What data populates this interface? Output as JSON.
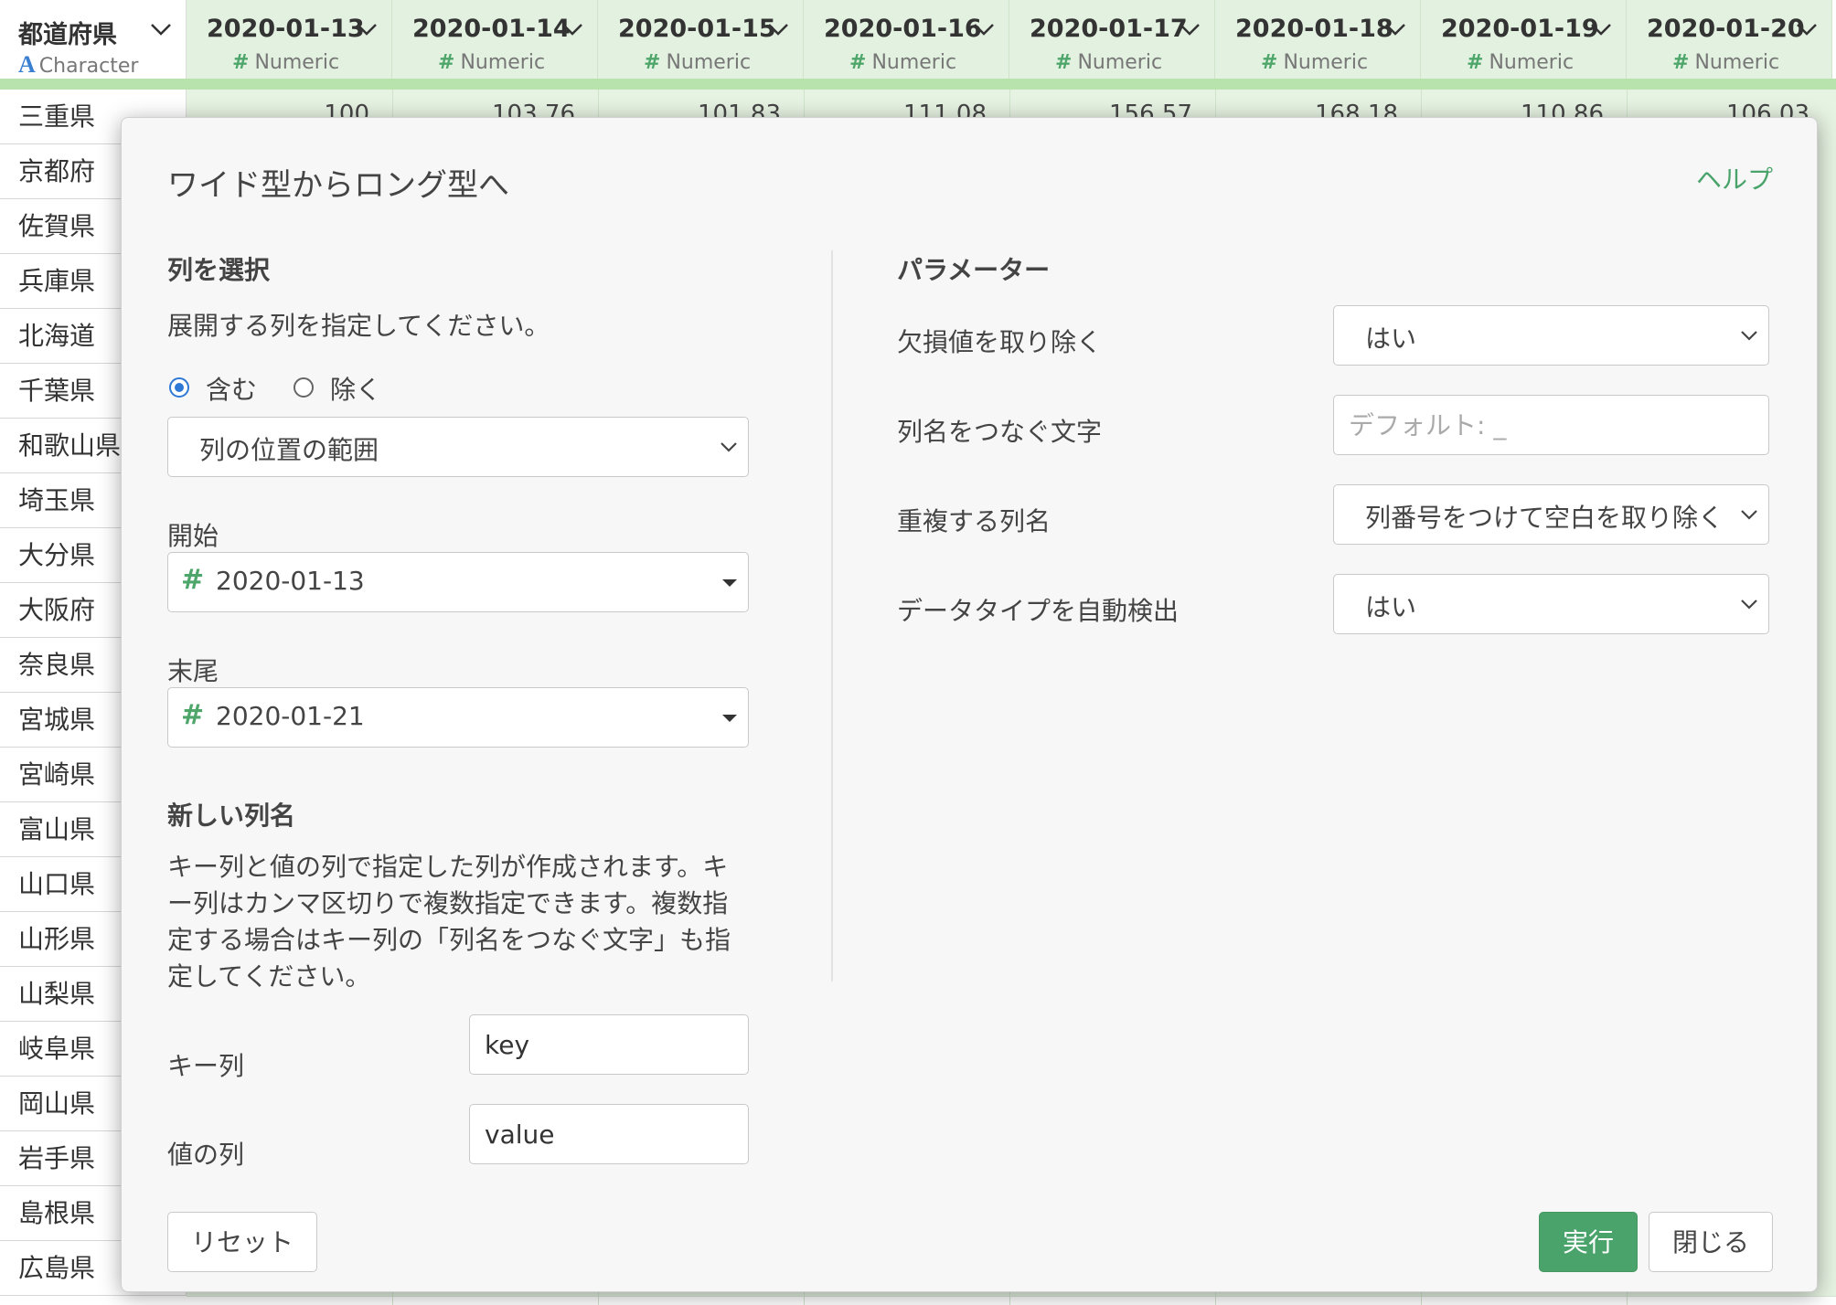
{
  "grid": {
    "first_column": {
      "name": "都道府県",
      "type_icon": "A",
      "type": "Character"
    },
    "columns": [
      {
        "name": "2020-01-13",
        "type": "Numeric",
        "first_value": "100"
      },
      {
        "name": "2020-01-14",
        "type": "Numeric",
        "first_value": "103.76"
      },
      {
        "name": "2020-01-15",
        "type": "Numeric",
        "first_value": "101.83"
      },
      {
        "name": "2020-01-16",
        "type": "Numeric",
        "first_value": "111.08"
      },
      {
        "name": "2020-01-17",
        "type": "Numeric",
        "first_value": "156.57"
      },
      {
        "name": "2020-01-18",
        "type": "Numeric",
        "first_value": "168.18"
      },
      {
        "name": "2020-01-19",
        "type": "Numeric",
        "first_value": "110.86"
      },
      {
        "name": "2020-01-20",
        "type": "Numeric",
        "first_value": "106.03"
      }
    ],
    "numeric_icon": "#",
    "rows": [
      "三重県",
      "京都府",
      "佐賀県",
      "兵庫県",
      "北海道",
      "千葉県",
      "和歌山県",
      "埼玉県",
      "大分県",
      "大阪府",
      "奈良県",
      "宮城県",
      "宮崎県",
      "富山県",
      "山口県",
      "山形県",
      "山梨県",
      "岐阜県",
      "岡山県",
      "岩手県",
      "島根県",
      "広島県"
    ]
  },
  "modal": {
    "title": "ワイド型からロング型へ",
    "help": "ヘルプ",
    "select_columns": {
      "title": "列を選択",
      "description": "展開する列を指定してください。",
      "include_label": "含む",
      "exclude_label": "除く",
      "mode": "列の位置の範囲",
      "start_label": "開始",
      "start_value": "2020-01-13",
      "end_label": "末尾",
      "end_value": "2020-01-21"
    },
    "new_columns": {
      "title": "新しい列名",
      "description": "キー列と値の列で指定した列が作成されます。キー列はカンマ区切りで複数指定できます。複数指定する場合はキー列の「列名をつなぐ文字」も指定してください。",
      "key_label": "キー列",
      "key_value": "key",
      "value_label": "値の列",
      "value_value": "value"
    },
    "parameters": {
      "title": "パラメーター",
      "remove_na_label": "欠損値を取り除く",
      "remove_na_value": "はい",
      "sep_label": "列名をつなぐ文字",
      "sep_placeholder": "デフォルト: _",
      "dup_label": "重複する列名",
      "dup_value": "列番号をつけて空白を取り除く",
      "detect_label": "データタイプを自動検出",
      "detect_value": "はい"
    },
    "buttons": {
      "reset": "リセット",
      "run": "実行",
      "close": "閉じる"
    }
  },
  "colors": {
    "accent": "#4aa36b",
    "header_bg": "#e3f1e0",
    "strip": "#b9e3ad",
    "radio": "#2e78d6"
  }
}
